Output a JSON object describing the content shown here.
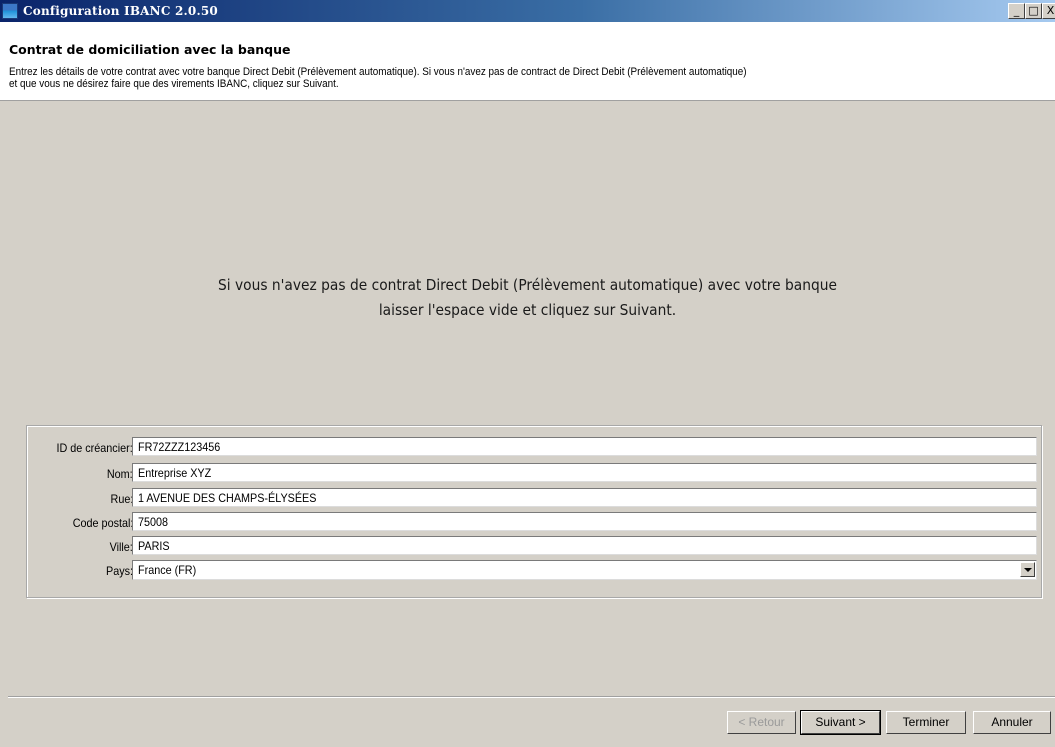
{
  "window": {
    "title": "Configuration IBANC 2.0.50",
    "minimize": "_",
    "maximize": "□",
    "close": "X"
  },
  "header": {
    "title": "Contrat de domiciliation avec la banque",
    "description": "Entrez les détails de votre contrat avec votre banque Direct Debit (Prélèvement automatique). Si vous n'avez pas de contract de Direct Debit (Prélèvement automatique)\n et que vous ne désirez faire que des virements IBANC, cliquez sur Suivant."
  },
  "info": {
    "line1": "Si vous n'avez pas de contrat Direct Debit (Prélèvement automatique) avec votre banque",
    "line2": "laisser l'espace vide et cliquez sur Suivant."
  },
  "form": {
    "creditor_id": {
      "label": "ID de créancier:",
      "value": "FR72ZZZ123456"
    },
    "name": {
      "label": "Nom:",
      "value": "Entreprise XYZ"
    },
    "street": {
      "label": "Rue:",
      "value": "1 AVENUE DES CHAMPS-ÉLYSÉES"
    },
    "postal_code": {
      "label": "Code postal:",
      "value": "75008"
    },
    "city": {
      "label": "Ville:",
      "value": "PARIS"
    },
    "country": {
      "label": "Pays:",
      "value": "France (FR)"
    }
  },
  "buttons": {
    "back": "< Retour",
    "next": "Suivant >",
    "finish": "Terminer",
    "cancel": "Annuler"
  }
}
